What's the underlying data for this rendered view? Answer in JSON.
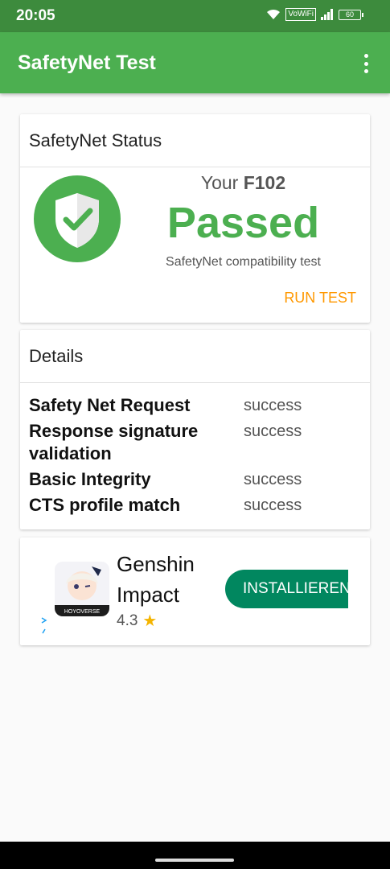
{
  "statusbar": {
    "time": "20:05",
    "vowifi": "VoWiFi",
    "battery": "60"
  },
  "appbar": {
    "title": "SafetyNet Test"
  },
  "status_card": {
    "header": "SafetyNet Status",
    "your_prefix": "Your",
    "device": "F102",
    "result": "Passed",
    "subtitle": "SafetyNet compatibility test",
    "run_test": "RUN TEST"
  },
  "details_card": {
    "header": "Details",
    "rows": [
      {
        "label": "Safety Net Request",
        "value": "success"
      },
      {
        "label": "Response signature validation",
        "value": "success"
      },
      {
        "label": "Basic Integrity",
        "value": "success"
      },
      {
        "label": "CTS profile match",
        "value": "success"
      }
    ]
  },
  "ad": {
    "name": "Genshin Impact",
    "rating": "4.3",
    "install": "INSTALLIEREN",
    "icon_text": "HOYOVERSE"
  },
  "colors": {
    "primary": "#4caf50",
    "primary_dark": "#3d8b3d",
    "accent": "#ff9800",
    "install": "#01875f"
  }
}
